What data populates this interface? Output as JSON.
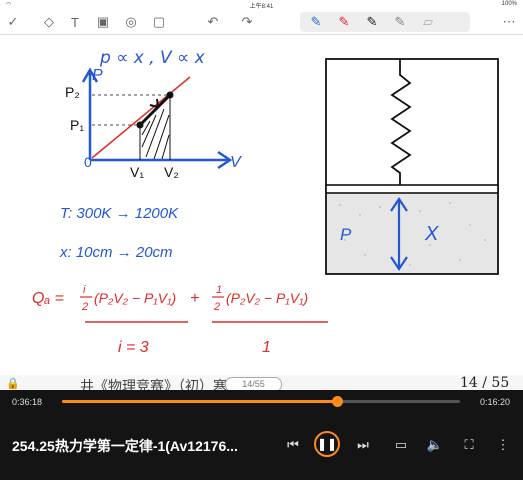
{
  "status_bar": {
    "time": "上午8:41",
    "battery": "100%"
  },
  "toolbar": {
    "left_icons": [
      "check-circle-icon",
      "eraser-icon",
      "text-tool-icon",
      "image-icon",
      "lasso-icon",
      "shapes-icon"
    ],
    "undo_icon": "undo-icon",
    "redo_icon": "redo-icon",
    "pens": [
      "pen-blue-icon",
      "pen-red-icon",
      "pen-black-icon",
      "pen-gray-icon",
      "highlighter-icon"
    ],
    "more_icon": "more-icon"
  },
  "notes": {
    "line1": "p ∝ x ,  V ∝ x",
    "p_label": "P",
    "p2": "P₂",
    "p1": "P₁",
    "origin": "0",
    "v1": "V₁",
    "v2": "V₂",
    "v_axis": "V",
    "t_row": "T:   300K  →  1200K",
    "x_row": "x:    10cm  →  20cm",
    "q_eq_lhs": "Qₐ =",
    "q_frac1": "i",
    "q_den1": "2",
    "q_expr1": "(P₂V₂ − P₁V₁)",
    "plus": "+",
    "q_frac2": "1",
    "q_den2": "2",
    "q_expr2": "(P₂V₂ − P₁V₁)",
    "i_eq": "i = 3",
    "one": "1",
    "diagram_p": "P",
    "diagram_x": "X"
  },
  "note_bar": {
    "title": "井《物理竞赛》（初）寒假（初）",
    "page_pill": "14/55",
    "page_counter": "14 / 55"
  },
  "player": {
    "elapsed": "0:36:18",
    "remaining": "0:16:20",
    "progress": 0.69,
    "title": "254.25热力学第一定律-1(Av12176...",
    "accent": "#ff8a1a"
  }
}
